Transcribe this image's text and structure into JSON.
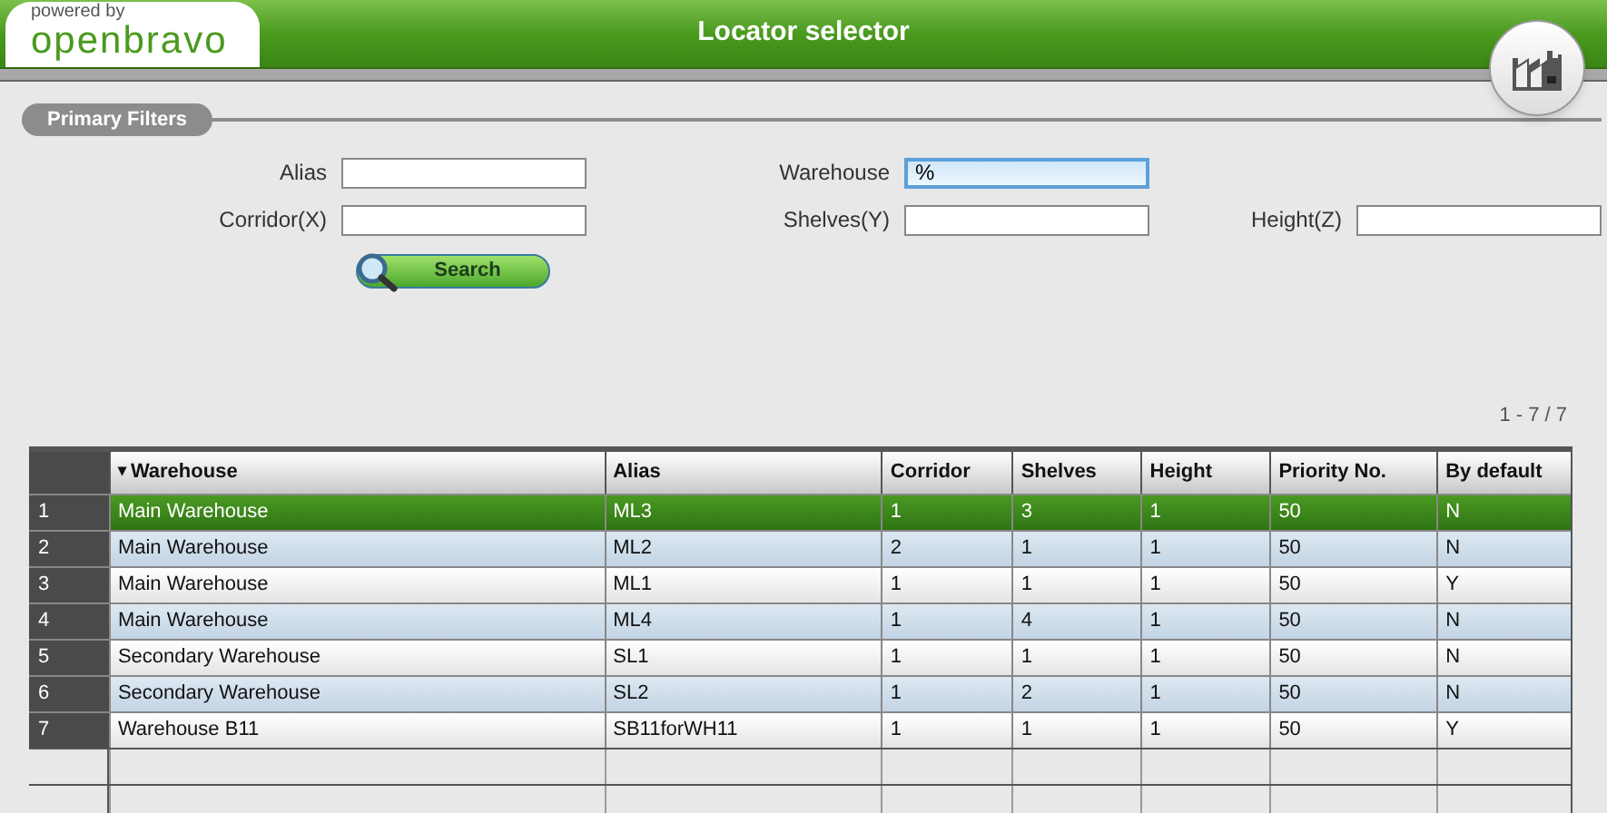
{
  "header": {
    "logo_caption": "powered by",
    "logo_name": "openbravo",
    "title": "Locator selector"
  },
  "filters": {
    "section_title": "Primary Filters",
    "fields": [
      {
        "label": "Alias",
        "focused": false
      },
      {
        "label": "Warehouse",
        "value": "%",
        "focused": true
      },
      {
        "label": "Corridor(X)",
        "focused": false
      },
      {
        "label": "Shelves(Y)",
        "focused": false
      },
      {
        "label": "Height(Z)",
        "focused": false
      }
    ],
    "search_button": "Search"
  },
  "table": {
    "count": "1 - 7 / 7",
    "columns": [
      {
        "label": "Warehouse",
        "sort": "▾"
      },
      {
        "label": "Alias"
      },
      {
        "label": "Corridor"
      },
      {
        "label": "Shelves"
      },
      {
        "label": "Height"
      },
      {
        "label": "Priority No."
      },
      {
        "label": "By default"
      }
    ],
    "rows": [
      {
        "number": "1",
        "selected": true,
        "cells": [
          "Main Warehouse",
          "ML3",
          "1",
          "3",
          "1",
          "50",
          "N"
        ]
      },
      {
        "number": "2",
        "selected": false,
        "cells": [
          "Main Warehouse",
          "ML2",
          "2",
          "1",
          "1",
          "50",
          "N"
        ]
      },
      {
        "number": "3",
        "selected": false,
        "cells": [
          "Main Warehouse",
          "ML1",
          "1",
          "1",
          "1",
          "50",
          "Y"
        ]
      },
      {
        "number": "4",
        "selected": false,
        "cells": [
          "Main Warehouse",
          "ML4",
          "1",
          "4",
          "1",
          "50",
          "N"
        ]
      },
      {
        "number": "5",
        "selected": false,
        "cells": [
          "Secondary Warehouse",
          "SL1",
          "1",
          "1",
          "1",
          "50",
          "N"
        ]
      },
      {
        "number": "6",
        "selected": false,
        "cells": [
          "Secondary Warehouse",
          "SL2",
          "1",
          "2",
          "1",
          "50",
          "N"
        ]
      },
      {
        "number": "7",
        "selected": false,
        "cells": [
          "Warehouse B11",
          "SB11forWH11",
          "1",
          "1",
          "1",
          "50",
          "Y"
        ]
      }
    ]
  }
}
